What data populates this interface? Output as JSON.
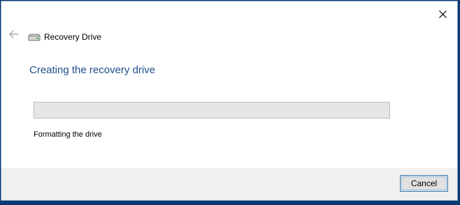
{
  "window": {
    "title": "Recovery Drive",
    "heading": "Creating the recovery drive",
    "status_text": "Formatting the drive"
  },
  "progress": {
    "value": 0
  },
  "footer": {
    "cancel_label": "Cancel"
  },
  "icons": {
    "back": "back-arrow-icon",
    "drive": "drive-icon",
    "close": "close-icon"
  },
  "colors": {
    "heading": "#1f4e8c",
    "progress_track": "#e6e6e6",
    "footer_bg": "#f0f0f0",
    "desktop_bg": "#0b3a73"
  }
}
